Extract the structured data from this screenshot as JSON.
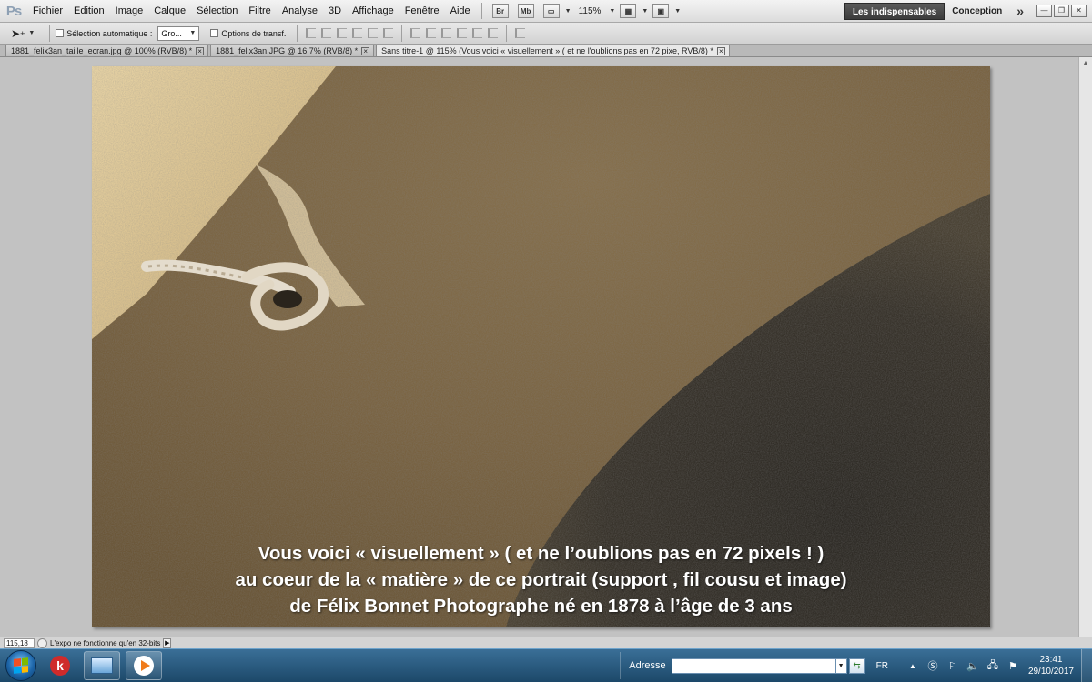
{
  "app": {
    "logo": "Ps"
  },
  "menu": [
    "Fichier",
    "Edition",
    "Image",
    "Calque",
    "Sélection",
    "Filtre",
    "Analyse",
    "3D",
    "Affichage",
    "Fenêtre",
    "Aide"
  ],
  "appbar": {
    "bridge_label": "Br",
    "minibridge_label": "Mb",
    "zoom": "115%",
    "workspace_active": "Les indispensables",
    "workspace_other": "Conception",
    "more": "»"
  },
  "options": {
    "auto_select_label": "Sélection automatique :",
    "auto_select_value": "Gro...",
    "transform_label": "Options de transf."
  },
  "tabs": [
    {
      "label": "1881_felix3an_taille_ecran.jpg @ 100% (RVB/8) *"
    },
    {
      "label": "1881_felix3an.JPG @ 16,7% (RVB/8) *"
    },
    {
      "label": "Sans titre-1 @ 115% (Vous voici « visuellement » ( et ne l'oublions pas en 72 pixe, RVB/8) *"
    }
  ],
  "caption": {
    "line1": "Vous voici « visuellement »  ( et  ne l’oublions pas en 72 pixels !  )",
    "line2": "au coeur de la « matière »  de ce portrait  (support , fil cousu et  image)",
    "line3": "de Félix Bonnet Photographe  né en 1878  à l’âge de 3 ans"
  },
  "status": {
    "zoom": "115,18 %",
    "message": "L'expo ne fonctionne qu'en 32-bits"
  },
  "taskbar": {
    "address_label": "Adresse",
    "address_value": "",
    "language": "FR",
    "time": "23:41",
    "date": "29/10/2017"
  },
  "colors": {
    "workspace_bg": "#c2c2c2",
    "taskbar": "#2a5a80",
    "active_workspace": "#3c3c3c"
  }
}
